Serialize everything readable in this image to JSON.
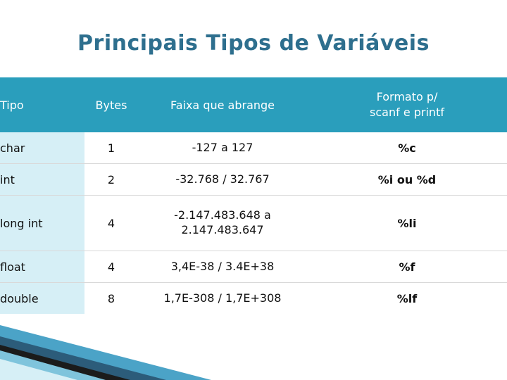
{
  "slide": {
    "title": "Principais Tipos de Variáveis",
    "accent_color": "#2a9ebc",
    "title_color": "#2e6f8e",
    "row_label_bg": "#d6eff6"
  },
  "table": {
    "headers": {
      "tipo": "Tipo",
      "bytes": "Bytes",
      "faixa": "Faixa que abrange",
      "formato_line1": "Formato p/",
      "formato_line2": "scanf e printf"
    },
    "rows": [
      {
        "tipo": "char",
        "bytes": "1",
        "faixa_line1": "-127 a 127",
        "faixa_line2": "",
        "formato": "%c"
      },
      {
        "tipo": "int",
        "bytes": "2",
        "faixa_line1": "-32.768 / 32.767",
        "faixa_line2": "",
        "formato": "%i ou %d"
      },
      {
        "tipo": "long int",
        "bytes": "4",
        "faixa_line1": "-2.147.483.648 a",
        "faixa_line2": "2.147.483.647",
        "formato": "%li"
      },
      {
        "tipo": "float",
        "bytes": "4",
        "faixa_line1": "3,4E-38 / 3.4E+38",
        "faixa_line2": "",
        "formato": "%f"
      },
      {
        "tipo": "double",
        "bytes": "8",
        "faixa_line1": "1,7E-308 / 1,7E+308",
        "faixa_line2": "",
        "formato": "%lf"
      }
    ]
  }
}
